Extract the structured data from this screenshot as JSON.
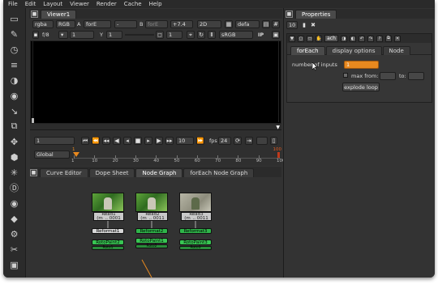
{
  "menubar": [
    "File",
    "Edit",
    "Layout",
    "Viewer",
    "Render",
    "Cache",
    "Help"
  ],
  "viewer": {
    "tab": "Viewer1",
    "channels": "rgba",
    "channel_mode": "RGB",
    "input_a": "forE",
    "input_a_label": "A",
    "wipe": "-",
    "input_b_label": "B",
    "input_b": "forE",
    "gain_label": "+7.4",
    "view_mode": "2D",
    "lut": "defa",
    "fstop": "f/8",
    "frame": "1",
    "y_label": "Y",
    "gamma": "1",
    "proxy": "1",
    "colorspace": "sRGB",
    "ip_label": "IP"
  },
  "transport": {
    "frame_field": "1",
    "increment": "10",
    "fps_label": "fps",
    "fps": "24",
    "range_mode": "Global",
    "in_marker": "1",
    "out_marker": "100",
    "ticks": [
      "1",
      "10",
      "20",
      "30",
      "40",
      "50",
      "60",
      "70",
      "80",
      "90",
      "100"
    ]
  },
  "properties": {
    "title": "Properties",
    "max_panels": "10",
    "node_name": "ach",
    "tabs": [
      "forEach",
      "display options",
      "Node"
    ],
    "number_of_inputs_label": "number of inputs",
    "number_of_inputs_value": "1",
    "max_from_label": "max from:",
    "to_label": "to:",
    "explode_loop": "explode loop"
  },
  "graph_tabs": [
    "Curve Editor",
    "Dope Sheet",
    "Node Graph",
    "forEach Node Graph"
  ],
  "nodes": [
    {
      "label": "Read1",
      "file": "(m_.. 0001",
      "pill1": "Reformat1",
      "pill2": "RotoPaint2",
      "pill3": "Roto1"
    },
    {
      "label": "Read2",
      "file": "(m_.. 0011",
      "pill1": "Reformat2",
      "pill2": "RotoPaint1",
      "pill3": "Roto2"
    },
    {
      "label": "Read3",
      "file": "(m_.. 0011",
      "pill1": "Reformat3",
      "pill2": "RotoPaint3",
      "pill3": "Roto3"
    }
  ],
  "colors": {
    "bg": "#323232",
    "viewport": "#000000",
    "accent_orange": "#e8891f",
    "reformat_pill": "#6fb36b",
    "roto_pill": "#2fb54a",
    "highlight": "#d6d6d6"
  }
}
